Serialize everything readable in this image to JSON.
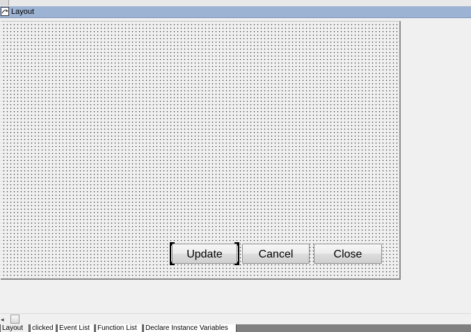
{
  "window": {
    "title": "Layout"
  },
  "buttons": {
    "update": "Update",
    "cancel": "Cancel",
    "close": "Close"
  },
  "scroll": {
    "left_arrow": "◂"
  },
  "tabs": [
    {
      "label": "Layout",
      "active": true
    },
    {
      "label": "clicked",
      "active": false
    },
    {
      "label": "Event List",
      "active": false
    },
    {
      "label": "Function List",
      "active": false
    },
    {
      "label": "Declare Instance Variables",
      "active": false
    }
  ],
  "colors": {
    "title_bar": "#9db3d3",
    "background": "#f0f0f0",
    "tab_strip": "#808080"
  }
}
